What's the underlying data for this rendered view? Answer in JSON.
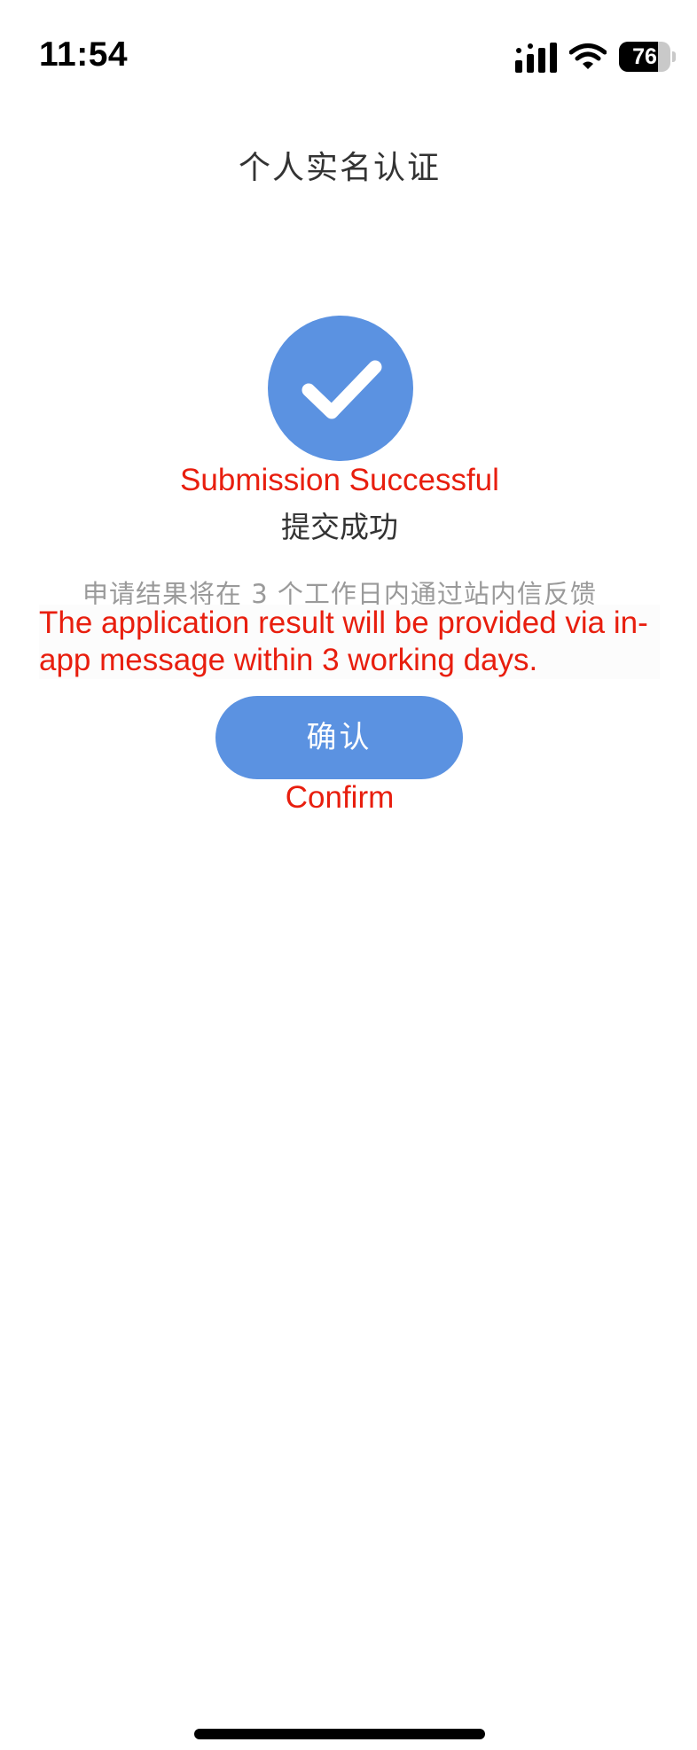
{
  "status_bar": {
    "time": "11:54",
    "icons": [
      "signal-icon",
      "wifi-icon",
      "battery-icon"
    ],
    "battery_level": "76",
    "battery_fraction": 0.76
  },
  "header": {
    "title": "个人实名认证"
  },
  "result": {
    "icon": "checkmark-circle-icon",
    "accent_color": "#5b92e1",
    "success_en": "Submission Successful",
    "success_zh": "提交成功",
    "desc_zh": "申请结果将在 3 个工作日内通过站内信反馈",
    "desc_en": "The application result will be provided via in-app message within 3 working days."
  },
  "confirm": {
    "label": "确认",
    "label_en": "Confirm"
  },
  "colors": {
    "translation_text": "#e81e0e",
    "button": "#5b92e1"
  }
}
